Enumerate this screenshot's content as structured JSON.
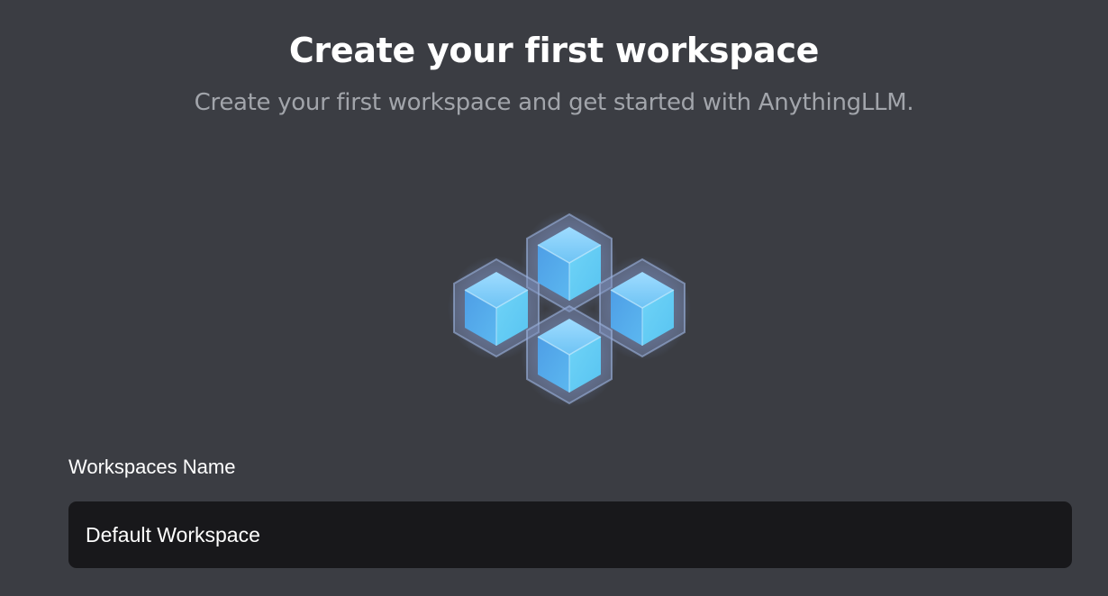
{
  "header": {
    "title": "Create your first workspace",
    "subtitle": "Create your first workspace and get started with AnythingLLM."
  },
  "illustration": {
    "icon": "workspace-cubes-icon",
    "cube_count": 4,
    "colors": {
      "cube_face": "#62c6f3",
      "cube_left": "#4aa2e6",
      "cube_right": "#62cdf3",
      "cube_top": "#8fdcff",
      "cube_glow": "#7fb8ff"
    }
  },
  "form": {
    "name_label": "Workspaces Name",
    "name_value": "Default Workspace"
  },
  "colors": {
    "background": "#3b3d43",
    "title": "#ffffff",
    "subtitle": "#a2a5ab",
    "input_background": "#18181b",
    "input_text": "#ffffff"
  }
}
